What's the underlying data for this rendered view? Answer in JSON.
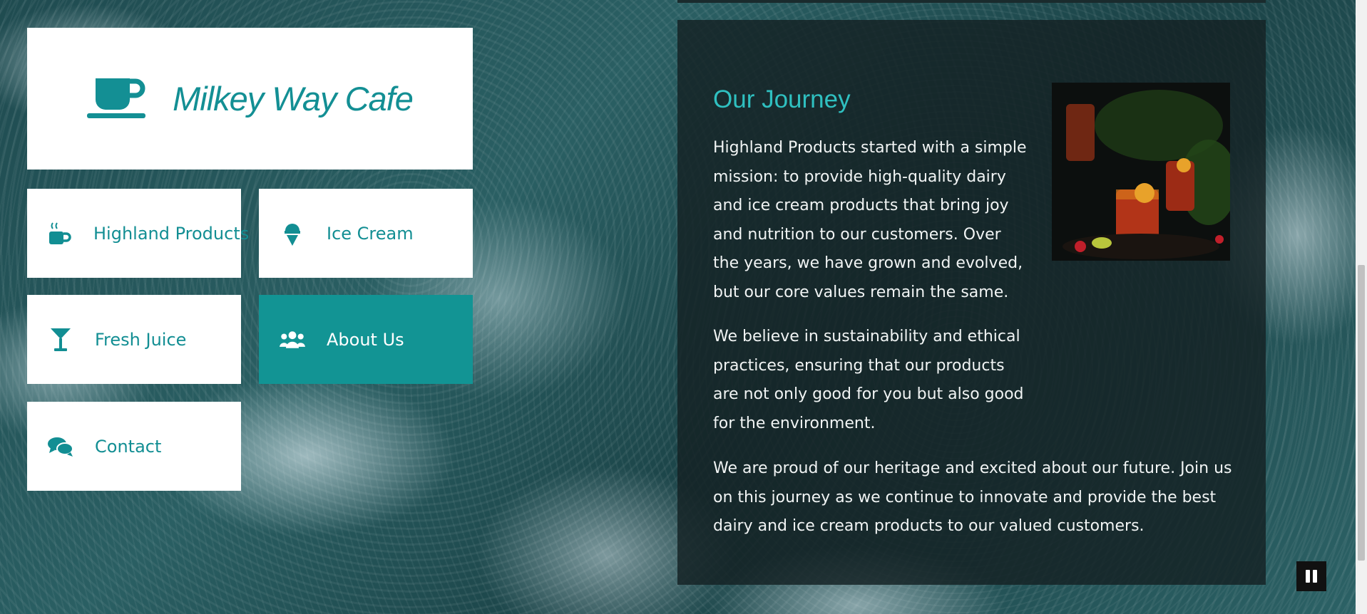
{
  "brand": {
    "name": "Milkey Way Cafe",
    "icon": "coffee-cup-icon",
    "color": "#138f94"
  },
  "nav": {
    "items": [
      {
        "label": "Highland Products",
        "icon": "mug-hot-icon",
        "active": false
      },
      {
        "label": "Ice Cream",
        "icon": "ice-cream-icon",
        "active": false
      },
      {
        "label": "Fresh Juice",
        "icon": "cocktail-glass-icon",
        "active": false
      },
      {
        "label": "About Us",
        "icon": "users-icon",
        "active": true
      },
      {
        "label": "Contact",
        "icon": "comments-icon",
        "active": false
      }
    ]
  },
  "about": {
    "heading": "Our Journey",
    "paragraphs": [
      "Highland Products started with a simple mission: to provide high-quality dairy and ice cream products that bring joy and nutrition to our customers. Over the years, we have grown and evolved, but our core values remain the same.",
      "We believe in sustainability and ethical practices, ensuring that our products are not only good for you but also good for the environment.",
      "We are proud of our heritage and excited about our future. Join us on this journey as we continue to innovate and provide the best dairy and ice cream products to our valued customers."
    ],
    "image_icon": "drinks-photo",
    "heading_color": "#2fc0c0"
  },
  "controls": {
    "pause_icon": "pause-icon"
  },
  "colors": {
    "accent": "#129494",
    "panel_bg": "#142224"
  }
}
